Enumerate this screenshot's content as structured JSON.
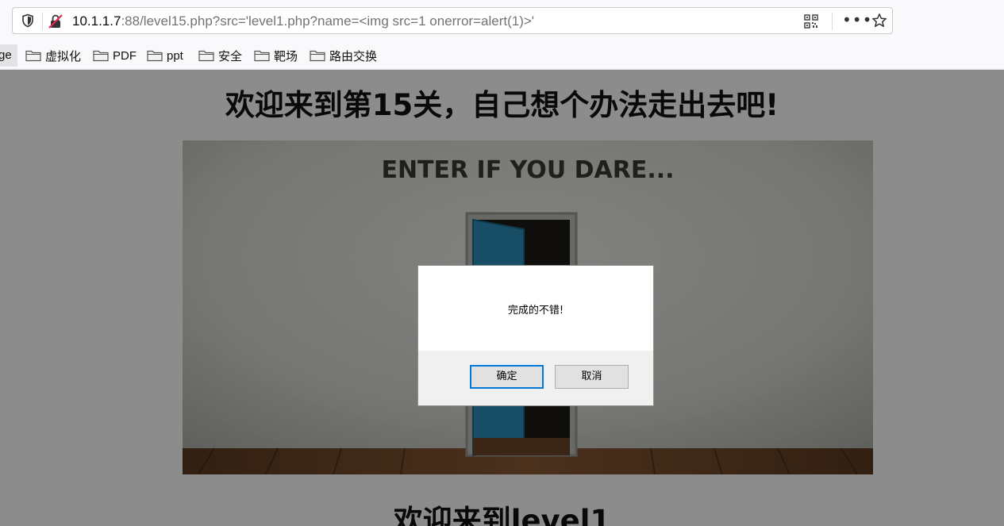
{
  "browser": {
    "url_host": "10.1.1.7",
    "url_rest": ":88/level15.php?src='level1.php?name=<img src=1 onerror=alert(1)>'",
    "more_label": "•••",
    "icons": [
      "shield-icon",
      "insecure-lock-icon",
      "qr-code-icon",
      "more-icon",
      "star-icon"
    ]
  },
  "bookmarks": {
    "first_partial": "ge",
    "items": [
      {
        "label": "虚拟化"
      },
      {
        "label": "PDF"
      },
      {
        "label": "ppt"
      },
      {
        "label": "安全"
      },
      {
        "label": "靶场"
      },
      {
        "label": "路由交换"
      }
    ]
  },
  "page": {
    "heading": "欢迎来到第15关，自己想个办法走出去吧!",
    "image_caption": "ENTER IF YOU DARE...",
    "subheading": "欢迎来到level1"
  },
  "dialog": {
    "message": "完成的不错!",
    "ok_label": "确定",
    "cancel_label": "取消"
  },
  "colors": {
    "overlay": "#000000",
    "dialog_focus": "#0078d7",
    "door": "#2a8fb8"
  }
}
